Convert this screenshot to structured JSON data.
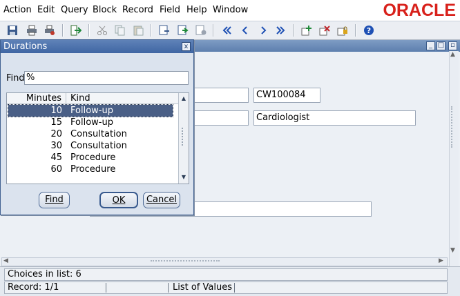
{
  "menubar": {
    "items": [
      "Action",
      "Edit",
      "Query",
      "Block",
      "Record",
      "Field",
      "Help",
      "Window"
    ],
    "logo_text": "ORACLE",
    "logo_color": "#d8211b"
  },
  "toolbar": {
    "icons": [
      "save-icon",
      "print-icon",
      "print-setup-icon",
      "exit-icon",
      "cut-icon",
      "copy-icon",
      "paste-icon",
      "enter-query-icon",
      "execute-query-icon",
      "cancel-query-icon",
      "first-record-icon",
      "previous-record-icon",
      "next-record-icon",
      "last-record-icon",
      "insert-record-icon",
      "delete-record-icon",
      "lock-record-icon",
      "help-icon"
    ]
  },
  "form": {
    "code_value": "CW100084",
    "specialty_value": "Cardiologist"
  },
  "lov": {
    "title": "Durations",
    "close_glyph": "x",
    "find_label": "Find",
    "find_value": "%",
    "columns": [
      "Minutes",
      "Kind"
    ],
    "rows": [
      {
        "minutes": "10",
        "kind": "Follow-up"
      },
      {
        "minutes": "15",
        "kind": "Follow-up"
      },
      {
        "minutes": "20",
        "kind": "Consultation"
      },
      {
        "minutes": "30",
        "kind": "Consultation"
      },
      {
        "minutes": "45",
        "kind": "Procedure"
      },
      {
        "minutes": "60",
        "kind": "Procedure"
      }
    ],
    "selected_row": 0,
    "buttons": {
      "find": "Find",
      "ok": "OK",
      "cancel": "Cancel"
    }
  },
  "status": {
    "message": "Choices in list: 6",
    "record": "Record: 1/1",
    "mode": "List of Values"
  },
  "colors": {
    "title_bar": "#4f72aa",
    "selection": "#4a5f86",
    "window_bg": "#ecf0f5"
  }
}
